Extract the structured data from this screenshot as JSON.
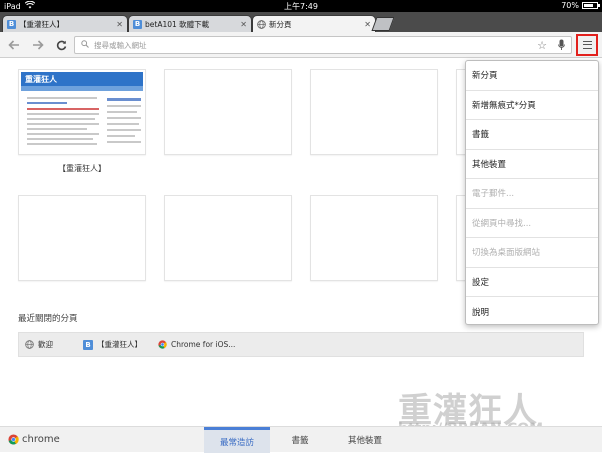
{
  "status_bar": {
    "device": "iPad",
    "time": "上午7:49",
    "battery": "70%"
  },
  "tabs": [
    {
      "favicon": "B",
      "title": "【重灌狂人】",
      "active": false
    },
    {
      "favicon": "B",
      "title": "betA101 軟體下載",
      "active": false
    },
    {
      "favicon": "globe-icon",
      "title": "新分頁",
      "active": true
    }
  ],
  "toolbar": {
    "omnibox_placeholder": "搜尋或輸入網址"
  },
  "most_visited": {
    "first_caption": "【重灌狂人】",
    "first_preview_brand": "重灌狂人"
  },
  "recently_closed": {
    "title": "最近關閉的分頁",
    "items": [
      {
        "icon": "globe-icon",
        "label": "歡迎"
      },
      {
        "icon": "B",
        "label": "【重灌狂人】"
      },
      {
        "icon": "chrome-icon",
        "label": "Chrome for iOS..."
      }
    ]
  },
  "bottom_bar": {
    "brand": "chrome",
    "tabs": [
      {
        "label": "最常造訪",
        "active": true
      },
      {
        "label": "書籤",
        "active": false
      },
      {
        "label": "其他裝置",
        "active": false
      }
    ]
  },
  "menu": {
    "items": [
      {
        "label": "新分頁",
        "enabled": true
      },
      {
        "label": "新增無痕式*分頁",
        "enabled": true
      },
      {
        "label": "書籤",
        "enabled": true
      },
      {
        "label": "其他裝置",
        "enabled": true
      },
      {
        "label": "電子郵件...",
        "enabled": false
      },
      {
        "label": "從網頁中尋找...",
        "enabled": false
      },
      {
        "label": "切換為桌面版網站",
        "enabled": false
      },
      {
        "label": "設定",
        "enabled": true
      },
      {
        "label": "說明",
        "enabled": true
      }
    ]
  },
  "watermark": {
    "text": "重灌狂人",
    "url": "http://BRIIAN.COM"
  },
  "colors": {
    "menu_button_highlight": "#e2201c",
    "active_bottom_tab": "#4a7fd6",
    "tabstrip": "#4b4b4b"
  }
}
